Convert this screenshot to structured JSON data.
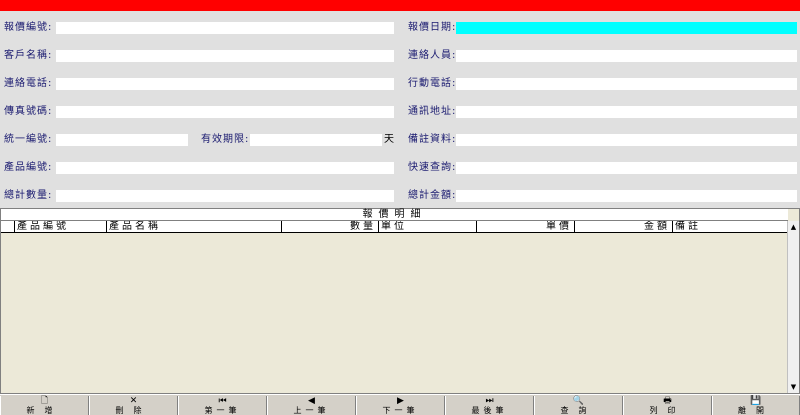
{
  "form": {
    "quote_no_label": "報價編號:",
    "quote_date_label": "報價日期:",
    "customer_label": "客戶名稱:",
    "contact_label": "連絡人員:",
    "phone_label": "連絡電話:",
    "mobile_label": "行動電話:",
    "fax_label": "傳真號碼:",
    "address_label": "通訊地址:",
    "tax_id_label": "統一編號:",
    "validity_label": "有效期限:",
    "validity_unit": "天",
    "remarks_label": "備註資料:",
    "product_no_label": "產品編號:",
    "quick_search_label": "快速查詢:",
    "total_qty_label": "總計數量:",
    "total_amount_label": "總計金額:",
    "values": {
      "quote_no": "",
      "quote_date": "",
      "customer": "",
      "contact": "",
      "phone": "",
      "mobile": "",
      "fax": "",
      "address": "",
      "tax_id": "",
      "validity": "",
      "remarks": "",
      "product_no": "",
      "quick_search": "",
      "total_qty": "",
      "total_amount": ""
    }
  },
  "grid": {
    "title": "報價明細",
    "columns": [
      "產品編號",
      "產品名稱",
      "數量",
      "單位",
      "單價",
      "金額",
      "備註"
    ]
  },
  "toolbar": {
    "new": "新增",
    "delete": "刪除",
    "first": "第一筆",
    "prev": "上一筆",
    "next": "下一筆",
    "last": "最後筆",
    "query": "查詢",
    "print": "列印",
    "exit": "離開"
  },
  "colors": {
    "title_bar": "#ff0000",
    "date_field": "#00ffff",
    "label": "#1a1a70"
  }
}
